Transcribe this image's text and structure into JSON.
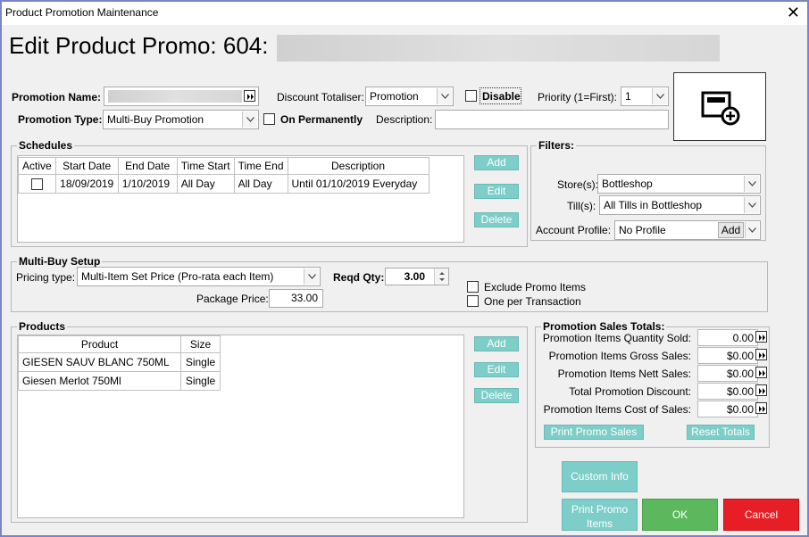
{
  "window": {
    "title": "Product Promotion Maintenance",
    "close_glyph": "✕"
  },
  "header": {
    "title": "Edit Product Promo: 604:"
  },
  "form": {
    "promotion_name_label": "Promotion Name:",
    "discount_totaliser_label": "Discount Totaliser:",
    "discount_totaliser_value": "Promotion",
    "disable_label": "Disable",
    "priority_label": "Priority (1=First):",
    "priority_value": "1",
    "promotion_type_label": "Promotion Type:",
    "promotion_type_value": "Multi-Buy Promotion",
    "on_permanently_label": "On Permanently",
    "description_label": "Description:",
    "description_value": ""
  },
  "schedules": {
    "title": "Schedules",
    "columns": [
      "Active",
      "Start Date",
      "End Date",
      "Time Start",
      "Time End",
      "Description"
    ],
    "rows": [
      {
        "active": false,
        "start_date": "18/09/2019",
        "end_date": "1/10/2019",
        "time_start": "All Day",
        "time_end": "All Day",
        "description": "Until 01/10/2019 Everyday"
      }
    ],
    "add_label": "Add",
    "edit_label": "Edit",
    "delete_label": "Delete"
  },
  "filters": {
    "title": "Filters:",
    "store_label": "Store(s):",
    "store_value": "Bottleshop",
    "till_label": "Till(s):",
    "till_value": "All Tills in Bottleshop",
    "account_profile_label": "Account Profile:",
    "account_profile_value": "No Profile",
    "account_add_label": "Add"
  },
  "multibuy": {
    "title": "Multi-Buy Setup",
    "pricing_type_label": "Pricing type:",
    "pricing_type_value": "Multi-Item Set Price (Pro-rata each Item)",
    "reqd_qty_label": "Reqd Qty:",
    "reqd_qty_value": "3.00",
    "package_price_label": "Package Price:",
    "package_price_value": "33.00",
    "exclude_promo_label": "Exclude Promo Items",
    "one_per_transaction_label": "One per Transaction"
  },
  "products": {
    "title": "Products",
    "columns": [
      "Product",
      "Size"
    ],
    "rows": [
      {
        "product": "GIESEN SAUV BLANC 750ML",
        "size": "Single"
      },
      {
        "product": "Giesen Merlot 750Ml",
        "size": "Single"
      }
    ],
    "add_label": "Add",
    "edit_label": "Edit",
    "delete_label": "Delete"
  },
  "totals": {
    "title": "Promotion Sales Totals:",
    "items": [
      {
        "label": "Promotion Items Quantity Sold:",
        "value": "0.00"
      },
      {
        "label": "Promotion Items Gross Sales:",
        "value": "$0.00"
      },
      {
        "label": "Promotion Items Nett Sales:",
        "value": "$0.00"
      },
      {
        "label": "Total Promotion Discount:",
        "value": "$0.00"
      },
      {
        "label": "Promotion Items Cost of Sales:",
        "value": "$0.00"
      }
    ],
    "print_label": "Print Promo Sales",
    "reset_label": "Reset Totals"
  },
  "footer": {
    "custom_info_label": "Custom Info",
    "print_promo_items_label": "Print Promo Items",
    "ok_label": "OK",
    "cancel_label": "Cancel"
  },
  "colors": {
    "accent": "#7dcdc8",
    "ok": "#5cb85c",
    "cancel": "#e81e26",
    "border": "#7a86c4"
  },
  "icons": {
    "image_add": "image-add-icon",
    "dropdown": "chevron-down-icon",
    "jump": "double-arrow-icon"
  }
}
